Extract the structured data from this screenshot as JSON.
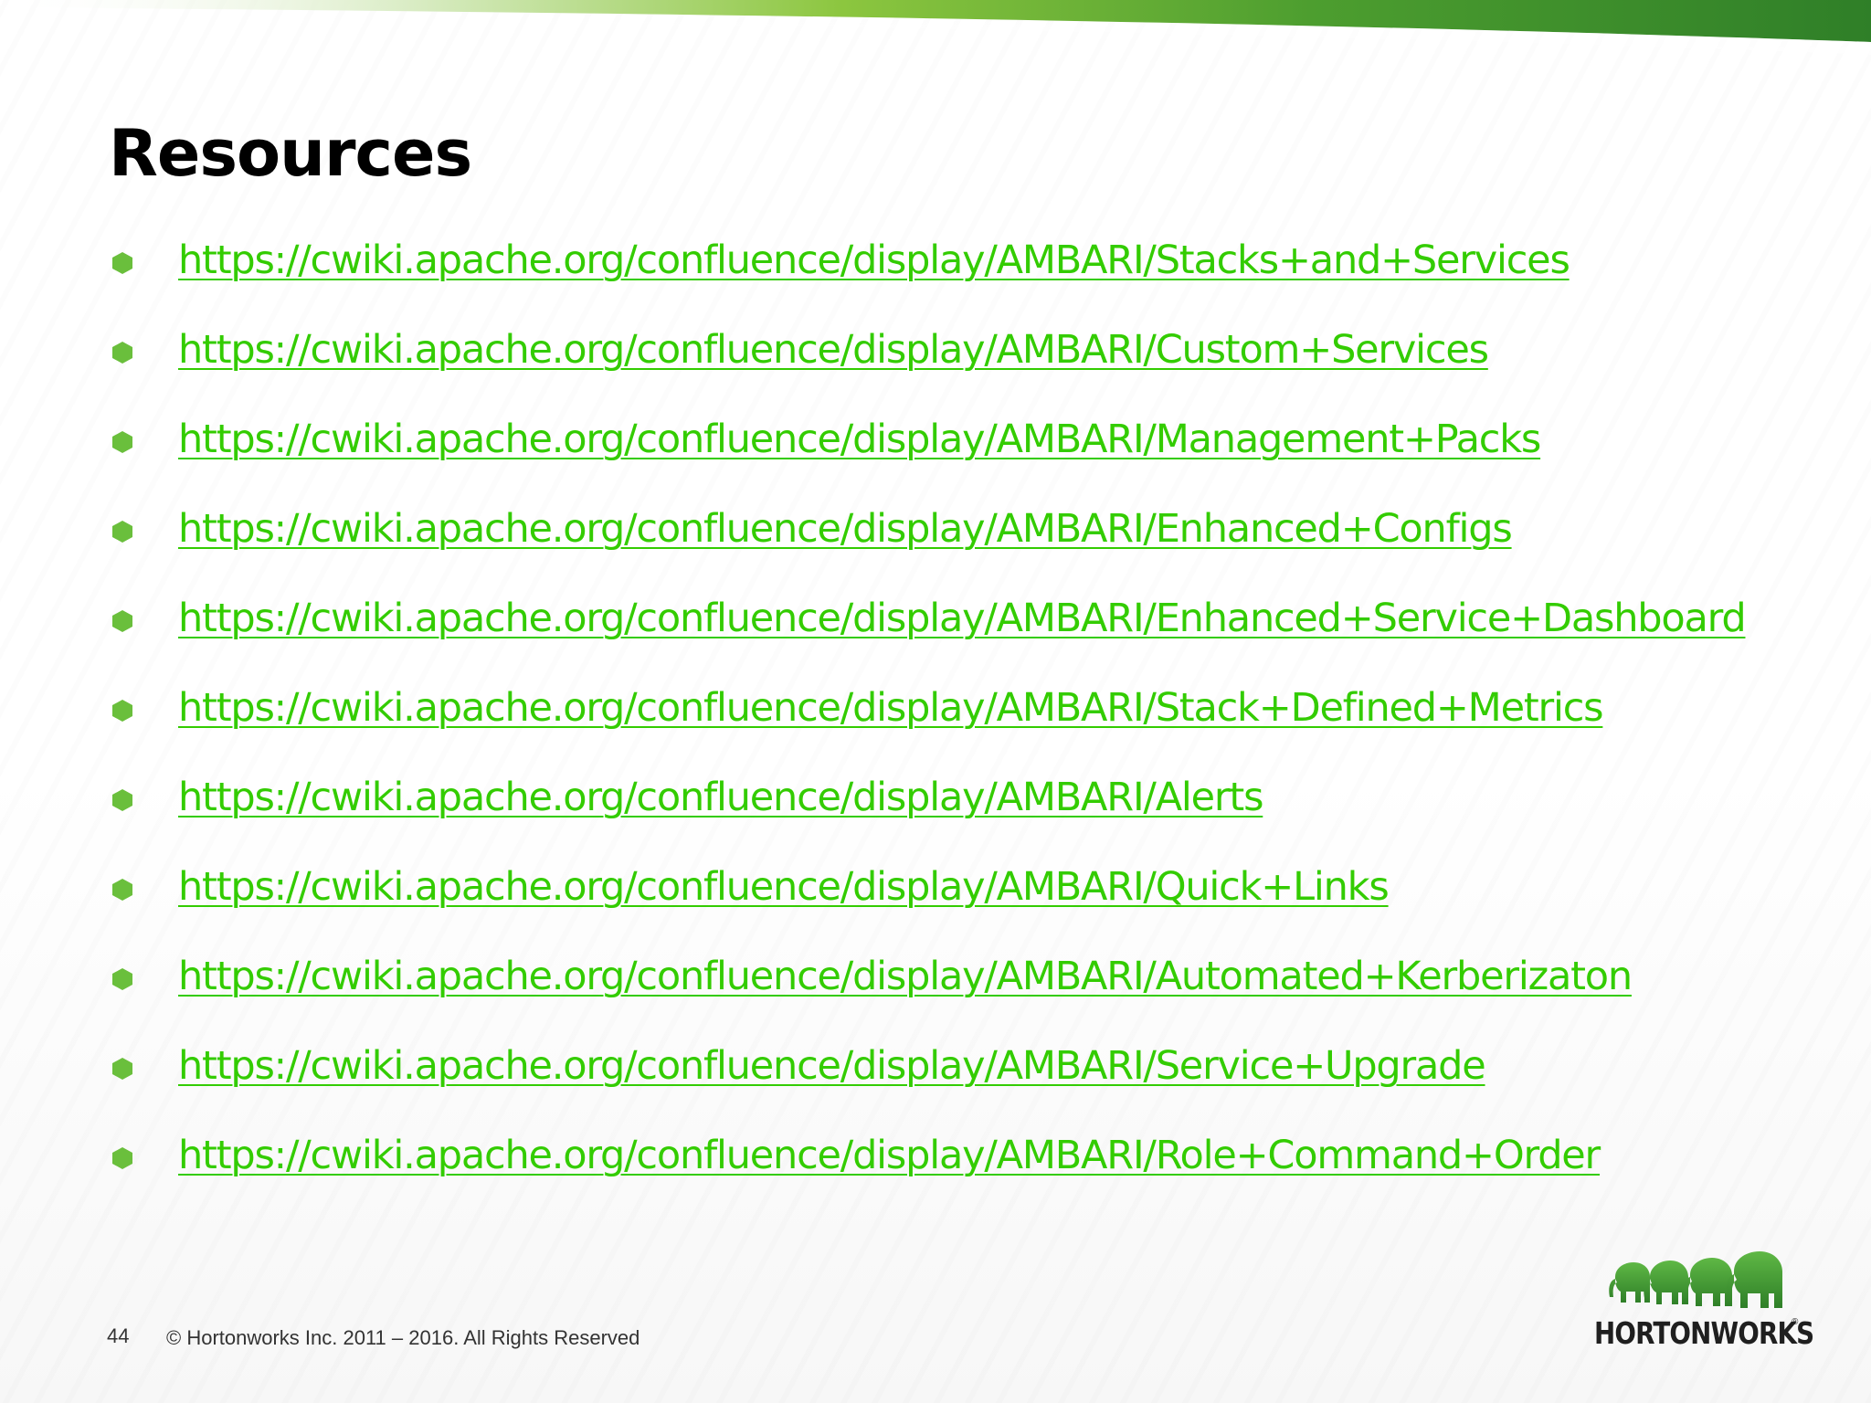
{
  "slide": {
    "title": "Resources",
    "page_number": "44",
    "copyright": "© Hortonworks Inc. 2011 – 2016. All Rights Reserved",
    "logo_text": "HORTONWORKS",
    "logo_mark": "®"
  },
  "links": [
    "https://cwiki.apache.org/confluence/display/AMBARI/Stacks+and+Services",
    "https://cwiki.apache.org/confluence/display/AMBARI/Custom+Services",
    "https://cwiki.apache.org/confluence/display/AMBARI/Management+Packs",
    "https://cwiki.apache.org/confluence/display/AMBARI/Enhanced+Configs",
    "https://cwiki.apache.org/confluence/display/AMBARI/Enhanced+Service+Dashboard",
    "https://cwiki.apache.org/confluence/display/AMBARI/Stack+Defined+Metrics",
    "https://cwiki.apache.org/confluence/display/AMBARI/Alerts",
    "https://cwiki.apache.org/confluence/display/AMBARI/Quick+Links",
    "https://cwiki.apache.org/confluence/display/AMBARI/Automated+Kerberizaton",
    "https://cwiki.apache.org/confluence/display/AMBARI/Service+Upgrade",
    "https://cwiki.apache.org/confluence/display/AMBARI/Role+Command+Order"
  ],
  "colors": {
    "link": "#33cc00",
    "bullet": "#6abf3c",
    "band_dark": "#2f8a2a",
    "band_light": "#8cc63f"
  },
  "icons": {
    "bullet": "hexagon-bullet-icon",
    "logo": "hortonworks-elephants-logo"
  }
}
